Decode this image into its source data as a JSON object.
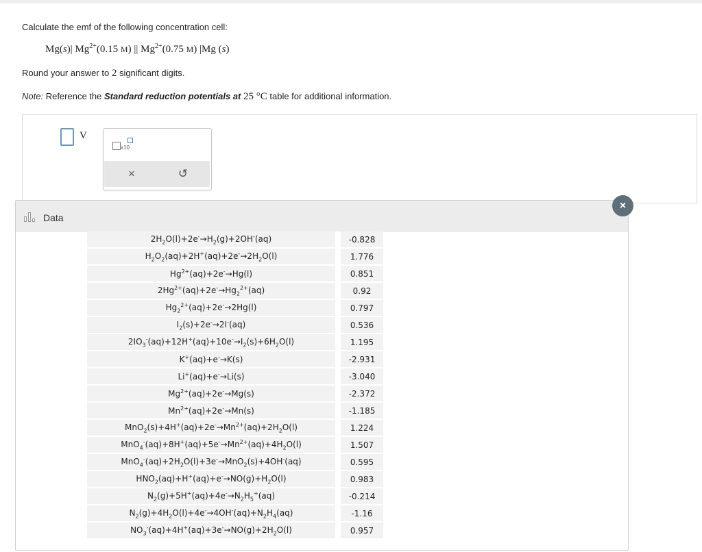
{
  "question": {
    "prompt": "Calculate the emf of the following concentration cell:",
    "cell": {
      "left_metal": "Mg",
      "left_state": "s",
      "ion1": "Mg",
      "ion1_charge": "2+",
      "conc1": "0.15",
      "conc_unit": "M",
      "ion2": "Mg",
      "ion2_charge": "2+",
      "conc2": "0.75",
      "right_metal": "Mg",
      "right_state": "s"
    },
    "round_prefix": "Round your answer to",
    "round_num": "2",
    "round_suffix": "significant digits.",
    "note_label": "Note:",
    "note_text": "Reference the",
    "note_bold": "Standard reduction potentials at",
    "note_temp": "25 °C",
    "note_suffix": "table for additional information."
  },
  "answer": {
    "value": "",
    "unit": "V",
    "tools": {
      "x10_label": "x10",
      "clear_symbol": "×",
      "undo_symbol": "↺"
    }
  },
  "data_panel": {
    "title": "Data",
    "close_symbol": "×",
    "rows": [
      {
        "reaction": "2H<sub>2</sub>O(l)+2e<sup>-</sup>→H<sub>2</sub>(g)+2OH<sup>-</sup>(aq)",
        "value": "-0.828"
      },
      {
        "reaction": "H<sub>2</sub>O<sub>2</sub>(aq)+2H<sup>+</sup>(aq)+2e<sup>-</sup>→2H<sub>2</sub>O(l)",
        "value": "1.776"
      },
      {
        "reaction": "Hg<sup>2+</sup>(aq)+2e<sup>-</sup>→Hg(l)",
        "value": "0.851"
      },
      {
        "reaction": "2Hg<sup>2+</sup>(aq)+2e<sup>-</sup>→Hg<sub>2</sub><sup>2+</sup>(aq)",
        "value": "0.92"
      },
      {
        "reaction": "Hg<sub>2</sub><sup>2+</sup>(aq)+2e<sup>-</sup>→2Hg(l)",
        "value": "0.797"
      },
      {
        "reaction": "I<sub>2</sub>(s)+2e<sup>-</sup>→2I<sup>-</sup>(aq)",
        "value": "0.536"
      },
      {
        "reaction": "2IO<sub>3</sub><sup>-</sup>(aq)+12H<sup>+</sup>(aq)+10e<sup>-</sup>→I<sub>2</sub>(s)+6H<sub>2</sub>O(l)",
        "value": "1.195"
      },
      {
        "reaction": "K<sup>+</sup>(aq)+e<sup>-</sup>→K(s)",
        "value": "-2.931"
      },
      {
        "reaction": "Li<sup>+</sup>(aq)+e<sup>-</sup>→Li(s)",
        "value": "-3.040"
      },
      {
        "reaction": "Mg<sup>2+</sup>(aq)+2e<sup>-</sup>→Mg(s)",
        "value": "-2.372"
      },
      {
        "reaction": "Mn<sup>2+</sup>(aq)+2e<sup>-</sup>→Mn(s)",
        "value": "-1.185"
      },
      {
        "reaction": "MnO<sub>2</sub>(s)+4H<sup>+</sup>(aq)+2e<sup>-</sup>→Mn<sup>2+</sup>(aq)+2H<sub>2</sub>O(l)",
        "value": "1.224"
      },
      {
        "reaction": "MnO<sub>4</sub><sup>-</sup>(aq)+8H<sup>+</sup>(aq)+5e<sup>-</sup>→Mn<sup>2+</sup>(aq)+4H<sub>2</sub>O(l)",
        "value": "1.507"
      },
      {
        "reaction": "MnO<sub>4</sub><sup>-</sup>(aq)+2H<sub>2</sub>O(l)+3e<sup>-</sup>→MnO<sub>2</sub>(s)+4OH<sup>-</sup>(aq)",
        "value": "0.595"
      },
      {
        "reaction": "HNO<sub>2</sub>(aq)+H<sup>+</sup>(aq)+e<sup>-</sup>→NO(g)+H<sub>2</sub>O(l)",
        "value": "0.983"
      },
      {
        "reaction": "N<sub>2</sub>(g)+5H<sup>+</sup>(aq)+4e<sup>-</sup>→N<sub>2</sub>H<sub>5</sub><sup>+</sup>(aq)",
        "value": "-0.214"
      },
      {
        "reaction": "N<sub>2</sub>(g)+4H<sub>2</sub>O(l)+4e<sup>-</sup>→4OH<sup>-</sup>(aq)+N<sub>2</sub>H<sub>4</sub>(aq)",
        "value": "-1.16"
      },
      {
        "reaction": "NO<sub>3</sub><sup>-</sup>(aq)+4H<sup>+</sup>(aq)+3e<sup>-</sup>→NO(g)+2H<sub>2</sub>O(l)",
        "value": "0.957"
      }
    ]
  }
}
